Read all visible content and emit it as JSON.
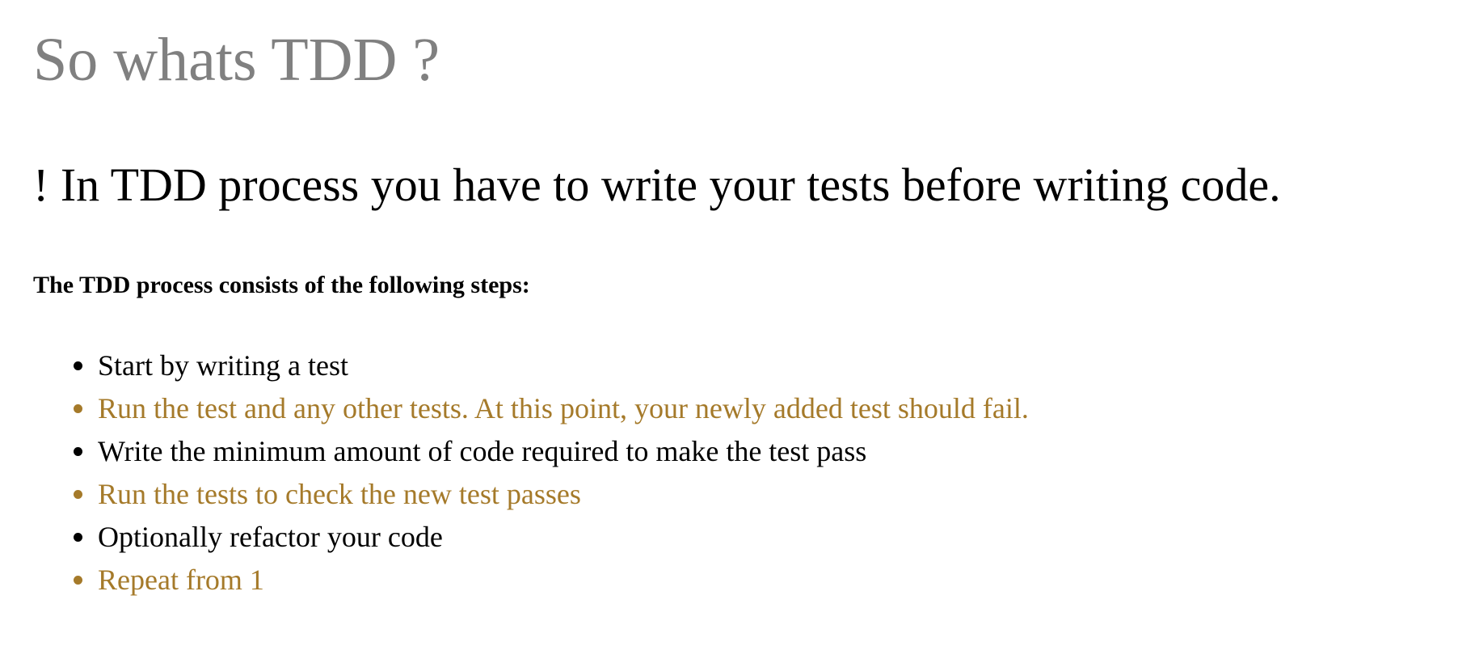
{
  "page": {
    "title": "So whats TDD ?",
    "lead": "! In TDD process you have to write your tests before writing code.",
    "intro": "The TDD process consists of the following steps:"
  },
  "colors": {
    "title": "#808080",
    "text": "#000000",
    "accent": "#a57a2a"
  },
  "steps": [
    {
      "label": "Start by writing a test",
      "accent": false
    },
    {
      "label": "Run the test and any other tests. At this point, your newly added test should fail.",
      "accent": true
    },
    {
      "label": "Write the minimum amount of code required to make the test pass",
      "accent": false
    },
    {
      "label": "Run the tests to check the new test passes",
      "accent": true
    },
    {
      "label": "Optionally refactor your code",
      "accent": false
    },
    {
      "label": "Repeat from 1",
      "accent": true
    }
  ]
}
